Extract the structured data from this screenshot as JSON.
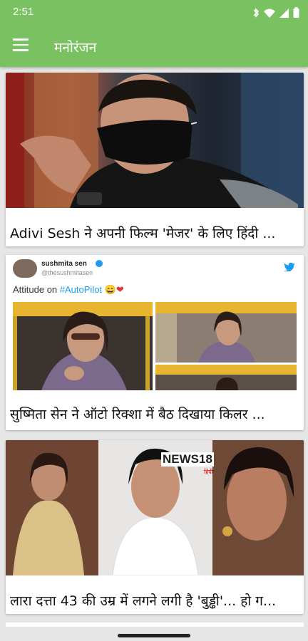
{
  "status_bar": {
    "time": "2:51"
  },
  "app_bar": {
    "title": "मनोरंजन",
    "menu_icon": "hamburger-menu-icon"
  },
  "colors": {
    "primary": "#7ac162",
    "background": "#e6e6e6",
    "card": "#ffffff",
    "twitter_blue": "#1d9bf0"
  },
  "articles": [
    {
      "title": "Adivi Sesh ने अपनी फिल्म 'मेजर' के लिए हिंदी ..."
    },
    {
      "title": "सुष्मिता सेन ने ऑटो रिक्शा में बैठ दिखाया किलर ...",
      "tweet": {
        "name": "sushmita sen",
        "handle": "@thesushmitasen",
        "text": "Attitude on ",
        "hashtag": "#AutoPilot",
        "emoji": "😄❤"
      }
    },
    {
      "title": "लारा दत्ता 43 की उम्र में लगने लगी है 'बुड्ढी'... हो ग...",
      "logo": "NEWS18",
      "logo_sub": "हिंदी"
    }
  ]
}
